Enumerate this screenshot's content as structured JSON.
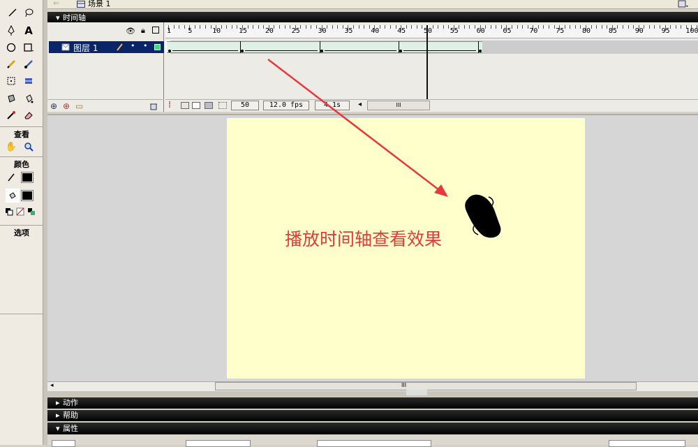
{
  "scene": {
    "label": "场景 1"
  },
  "timeline": {
    "title": "时间轴",
    "layer_name": "图层 1",
    "ruler_numbers": [
      "1",
      "5",
      "10",
      "15",
      "20",
      "25",
      "30",
      "35",
      "40",
      "45",
      "50",
      "55",
      "60",
      "65",
      "70",
      "75",
      "80",
      "85",
      "90",
      "95",
      "100"
    ],
    "current_frame": "50",
    "fps": "12.0 fps",
    "elapsed": "4.1s"
  },
  "toolbox": {
    "view_label": "查看",
    "color_label": "颜色",
    "options_label": "选项"
  },
  "stage": {
    "text": "播放时间轴查看效果",
    "text_color": "#e03c3c",
    "background": "#ffffcc",
    "arrow_color": "#e8383d"
  },
  "panels": {
    "actions": "动作",
    "help": "帮助",
    "properties": "属性"
  },
  "scroll": {
    "grip": "III"
  }
}
